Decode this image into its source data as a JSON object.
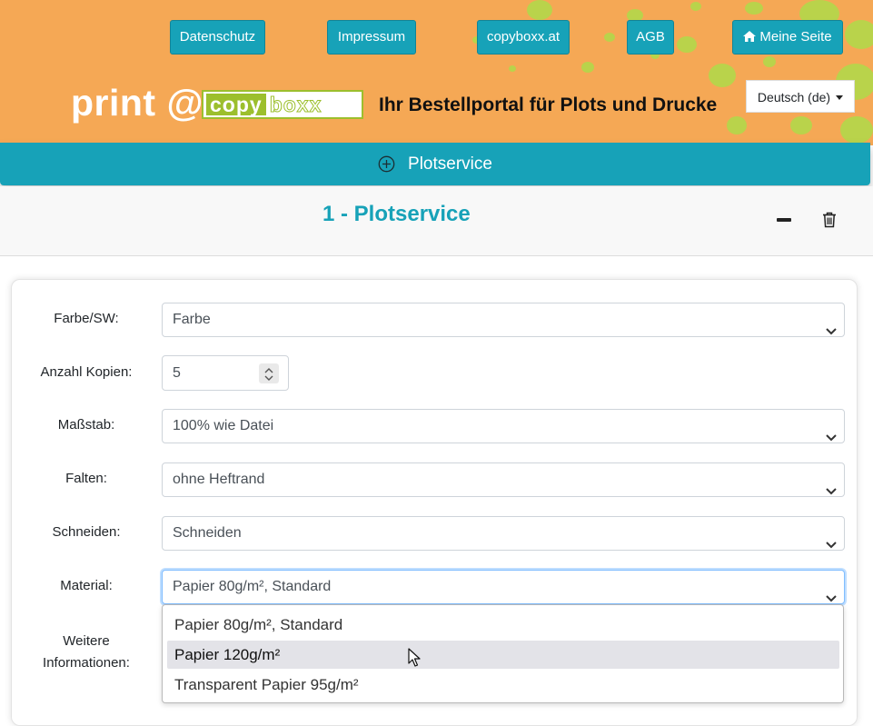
{
  "nav": {
    "links": [
      "Datenschutz",
      "Impressum",
      "copyboxx.at",
      "AGB"
    ],
    "home_label": "Meine Seite",
    "language": "Deutsch (de)"
  },
  "brand": {
    "prefix": "print @",
    "logo_part1": "copy",
    "logo_part2": "boxx",
    "tagline": "Ihr Bestellportal für Plots und Drucke"
  },
  "service_bar": {
    "label": "Plotservice"
  },
  "item": {
    "title": "1 - Plotservice"
  },
  "form": {
    "color_label": "Farbe/SW:",
    "color_value": "Farbe",
    "copies_label": "Anzahl Kopien:",
    "copies_value": "5",
    "scale_label": "Maßstab:",
    "scale_value": "100% wie Datei",
    "fold_label": "Falten:",
    "fold_value": "ohne Heftrand",
    "cut_label": "Schneiden:",
    "cut_value": "Schneiden",
    "material_label": "Material:",
    "material_value": "Papier 80g/m², Standard",
    "info_label_1": "Weitere",
    "info_label_2": "Informationen:"
  },
  "material_options": [
    "Papier 80g/m², Standard",
    "Papier 120g/m²",
    "Transparent Papier 95g/m²"
  ],
  "colors": {
    "header_bg": "#f5a855",
    "accent": "#17a2b8",
    "dots": "#b9d34b",
    "logo_green": "#9cbf2d"
  }
}
